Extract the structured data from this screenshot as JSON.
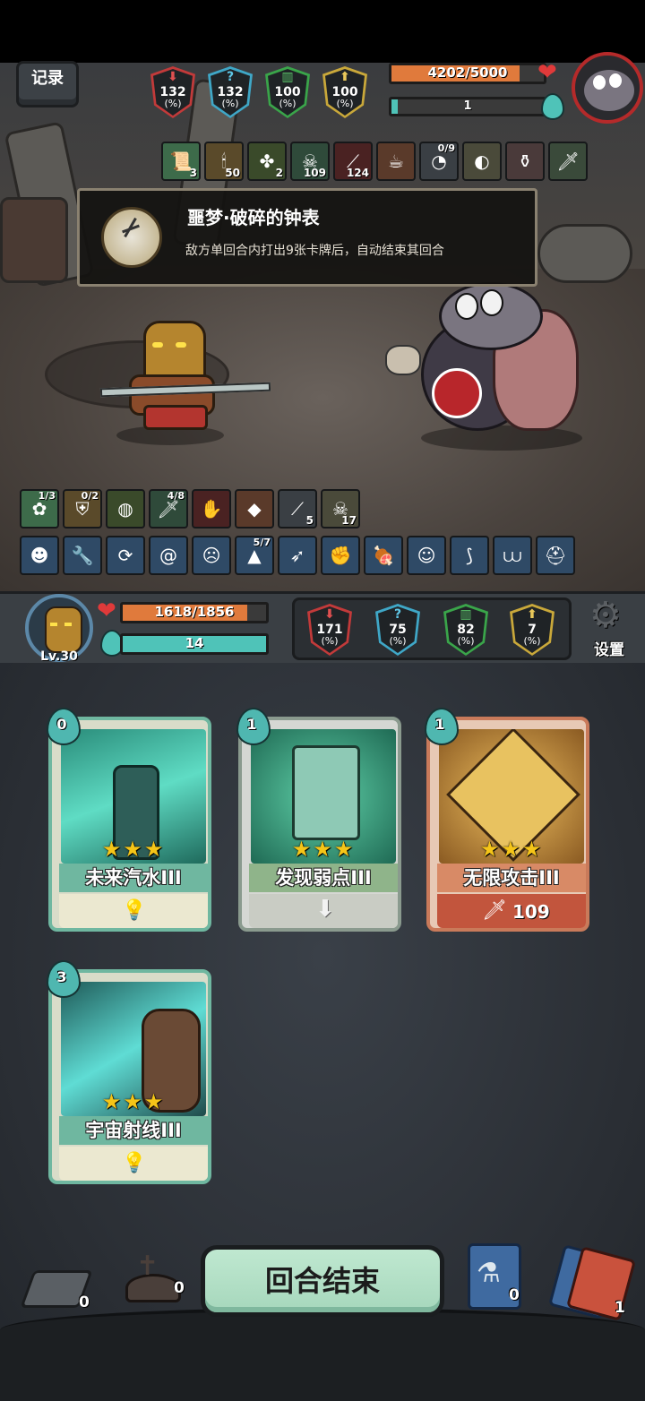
{
  "record_label": "记录",
  "enemy": {
    "hp_text": "4202/5000",
    "hp_fraction": 0.84,
    "energy_text": "1",
    "energy_fraction": 0.04,
    "stats": [
      {
        "icon": "attack-down-arrow-icon",
        "value": "132",
        "unit": "(%)",
        "color": "#c23a3a"
      },
      {
        "icon": "question-mark-icon",
        "value": "132",
        "unit": "(%)",
        "color": "#3fa7c7"
      },
      {
        "icon": "shield-bars-icon",
        "value": "100",
        "unit": "(%)",
        "color": "#3aa54a"
      },
      {
        "icon": "up-arrow-icon",
        "value": "100",
        "unit": "(%)",
        "color": "#c9a83a"
      }
    ],
    "buffs": [
      {
        "icon": "rune-scroll-icon",
        "count": "3"
      },
      {
        "icon": "candle-icon",
        "count": "50"
      },
      {
        "icon": "clover-icon",
        "count": "2"
      },
      {
        "icon": "skull-poison-icon",
        "count": "109"
      },
      {
        "icon": "bleed-slash-icon",
        "count": "124"
      },
      {
        "icon": "fire-cup-icon",
        "count": ""
      },
      {
        "icon": "broken-pocket-watch-icon",
        "top": "0/9"
      },
      {
        "icon": "dragon-egg-icon",
        "count": ""
      },
      {
        "icon": "vial-icon",
        "count": ""
      },
      {
        "icon": "slime-sword-icon",
        "count": ""
      }
    ]
  },
  "tooltip": {
    "title": "噩梦·破碎的钟表",
    "description": "敌方单回合内打出9张卡牌后，自动结束其回合"
  },
  "player_status_row1": [
    {
      "icon": "plant-icon",
      "top": "1/3"
    },
    {
      "icon": "armor-icon",
      "top": "0/2"
    },
    {
      "icon": "round-shield-icon",
      "top": ""
    },
    {
      "icon": "dagger-icon",
      "top": "4/8"
    },
    {
      "icon": "gauntlet-icon",
      "top": ""
    },
    {
      "icon": "purple-crystal-icon",
      "top": ""
    },
    {
      "icon": "bleed-slash-icon",
      "count": "5"
    },
    {
      "icon": "skull-poison-icon",
      "count": "17"
    }
  ],
  "player_status_row2": [
    {
      "icon": "demon-mask-icon"
    },
    {
      "icon": "wrench-icon"
    },
    {
      "icon": "cycle-clock-icon"
    },
    {
      "icon": "swirl-icon"
    },
    {
      "icon": "orc-face-icon"
    },
    {
      "icon": "wizard-hat-icon",
      "top": "5/7"
    },
    {
      "icon": "blue-kunai-icon"
    },
    {
      "icon": "leather-glove-icon"
    },
    {
      "icon": "meat-bone-icon"
    },
    {
      "icon": "red-imp-icon"
    },
    {
      "icon": "broom-icon"
    },
    {
      "icon": "trap-icon"
    },
    {
      "icon": "spartan-helmet-icon"
    }
  ],
  "player": {
    "level": "Lv.30",
    "hp_text": "1618/1856",
    "hp_fraction": 0.87,
    "energy_text": "14",
    "energy_fraction": 1.0,
    "stats": [
      {
        "icon": "attack-down-arrow-icon",
        "value": "171",
        "unit": "(%)",
        "color": "#c23a3a"
      },
      {
        "icon": "question-mark-icon",
        "value": "75",
        "unit": "(%)",
        "color": "#3fa7c7"
      },
      {
        "icon": "shield-bars-icon",
        "value": "82",
        "unit": "(%)",
        "color": "#3aa54a"
      },
      {
        "icon": "up-arrow-icon",
        "value": "7",
        "unit": "(%)",
        "color": "#c9a83a"
      }
    ],
    "settings_label": "设置"
  },
  "cards": [
    {
      "name": "未来汽水III",
      "cost": "0",
      "stars": "★★★",
      "footer": "",
      "footer_icon": "light-bulb-icon",
      "theme": "teal"
    },
    {
      "name": "发现弱点III",
      "cost": "1",
      "stars": "★★★",
      "footer": "",
      "footer_icon": "down-arrow-icon",
      "theme": "green"
    },
    {
      "name": "无限攻击III",
      "cost": "1",
      "stars": "★★★",
      "footer": "109",
      "footer_icon": "sword-icon",
      "theme": "orange"
    },
    {
      "name": "宇宙射线III",
      "cost": "3",
      "stars": "★★★",
      "footer": "",
      "footer_icon": "light-bulb-icon",
      "theme": "teal"
    }
  ],
  "bottom": {
    "draw_pile_count": "0",
    "graveyard_count": "0",
    "end_turn_label": "回合结束",
    "potion_count": "0",
    "discard_pile_count": "1"
  },
  "colors": {
    "hp_fill": "#e07a3c",
    "energy_fill": "#4fc3b8",
    "heart": "#e03a3a"
  }
}
